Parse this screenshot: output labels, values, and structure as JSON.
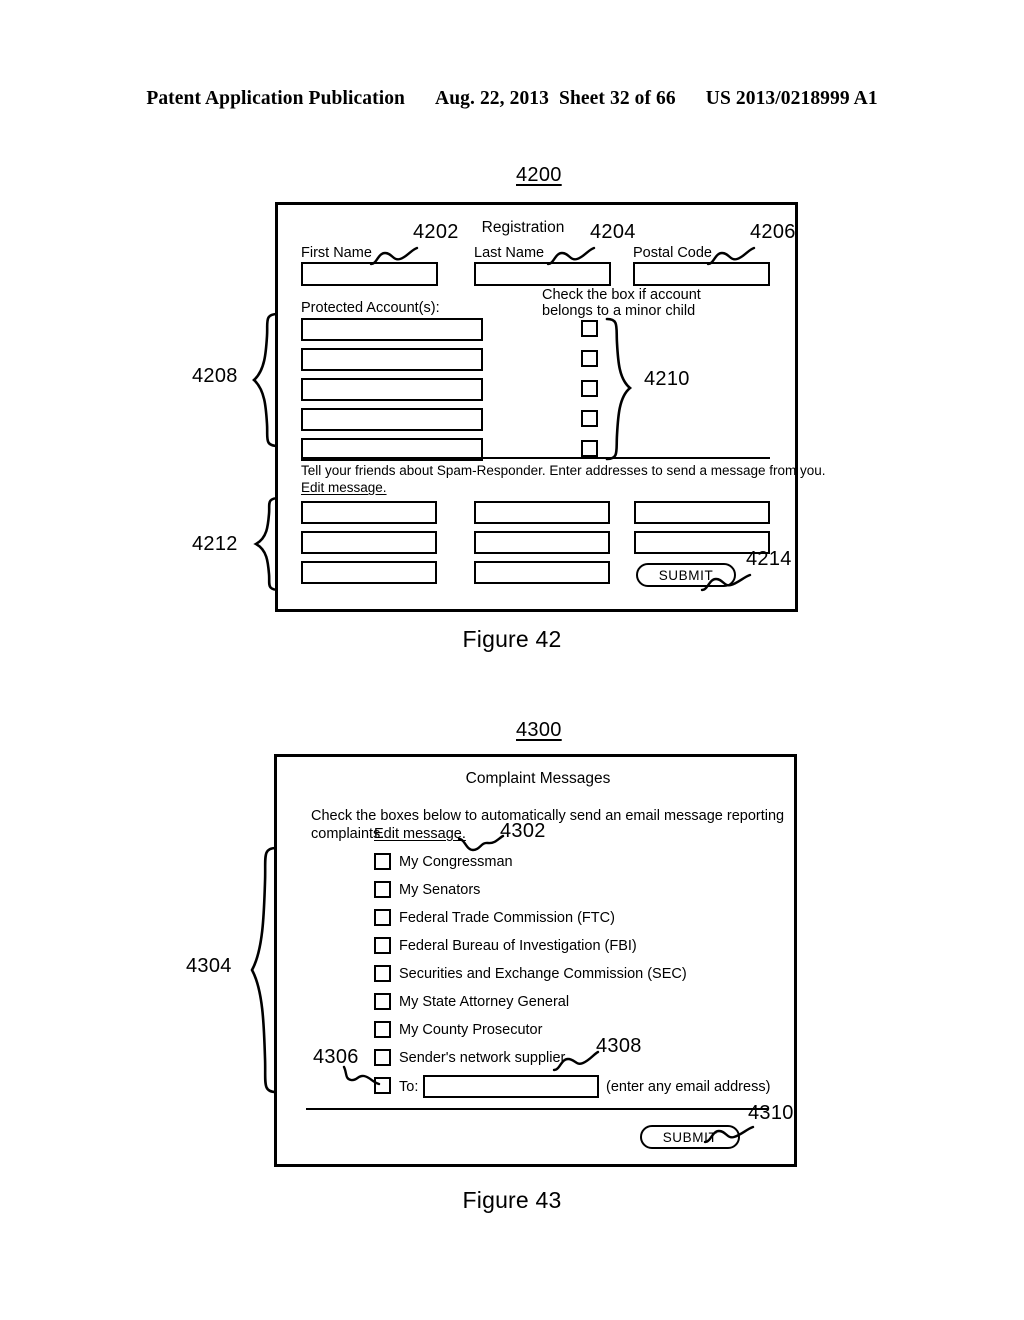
{
  "header": {
    "publication": "Patent Application Publication",
    "date": "Aug. 22, 2013",
    "sheet": "Sheet 32 of 66",
    "patent_number": "US 2013/0218999 A1"
  },
  "figure42": {
    "ref": "4200",
    "caption": "Figure 42",
    "title": "Registration",
    "fields": [
      {
        "label": "First Name",
        "ref": "4202",
        "value": ""
      },
      {
        "label": "Last Name",
        "ref": "4204",
        "value": ""
      },
      {
        "label": "Postal Code",
        "ref": "4206",
        "value": ""
      }
    ],
    "protected_accounts": {
      "label": "Protected Account(s):",
      "ref": "4208",
      "rows": [
        "",
        "",
        "",
        "",
        ""
      ]
    },
    "minor_child": {
      "label_line1": "Check the box if account",
      "label_line2": "belongs to a minor child",
      "ref": "4210",
      "checkboxes": [
        false,
        false,
        false,
        false,
        false
      ]
    },
    "tell_friends": {
      "line1": "Tell your friends about Spam-Responder. Enter addresses to send a message from you.",
      "edit_link": "Edit message.",
      "ref": "4212",
      "rows": [
        [
          "",
          "",
          ""
        ],
        [
          "",
          "",
          ""
        ],
        [
          "",
          ""
        ]
      ]
    },
    "submit": {
      "label": "SUBMIT",
      "ref": "4214"
    }
  },
  "figure43": {
    "ref": "4300",
    "caption": "Figure 43",
    "title": "Complaint Messages",
    "instruction": {
      "line1": "Check the boxes below to automatically send an email message reporting",
      "line2": "complaints.",
      "edit_link": "Edit message.",
      "ref": "4302"
    },
    "checklist": {
      "ref": "4304",
      "items": [
        {
          "label": "My Congressman",
          "checked": false
        },
        {
          "label": "My Senators",
          "checked": false
        },
        {
          "label": "Federal Trade Commission (FTC)",
          "checked": false
        },
        {
          "label": "Federal Bureau of Investigation (FBI)",
          "checked": false
        },
        {
          "label": "Securities and Exchange Commission (SEC)",
          "checked": false
        },
        {
          "label": "My State Attorney General",
          "checked": false
        },
        {
          "label": "My County Prosecutor",
          "checked": false
        },
        {
          "label": "Sender's network supplier",
          "checked": false
        }
      ]
    },
    "to_row": {
      "ref": "4306",
      "checked": false,
      "label": "To:",
      "input_value": "",
      "input_ref": "4308",
      "hint": "(enter any email address)"
    },
    "submit": {
      "label": "SUBMIT",
      "ref": "4310"
    }
  }
}
